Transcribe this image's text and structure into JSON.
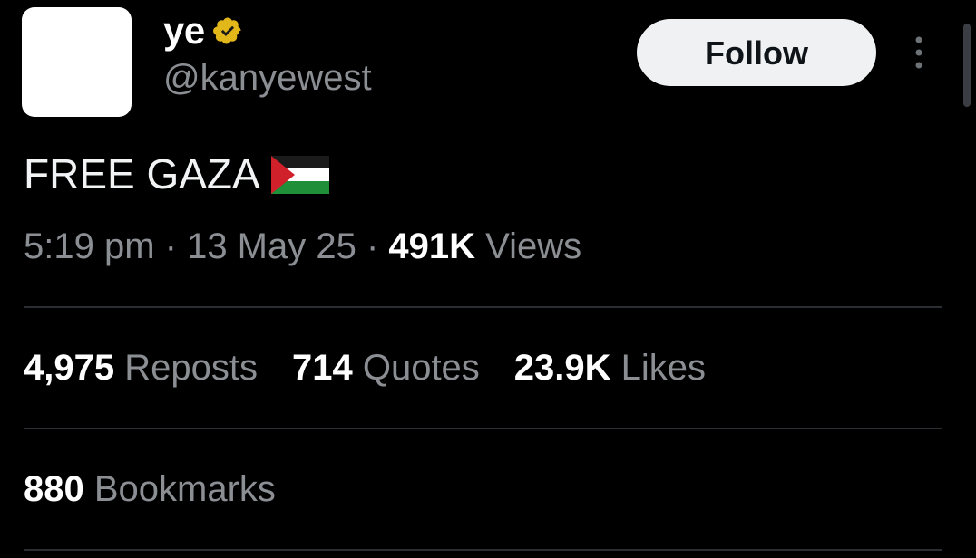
{
  "author": {
    "display_name": "ye",
    "handle": "@kanyewest",
    "verified_icon": "verified-badge-icon",
    "verified_color": "#e2b719"
  },
  "actions": {
    "follow_label": "Follow",
    "more_icon": "more-vertical-icon"
  },
  "tweet": {
    "text": "FREE GAZA",
    "emoji_icon": "palestine-flag-icon"
  },
  "meta": {
    "time": "5:19 pm",
    "sep1": " · ",
    "date": "13 May 25",
    "sep2": " · ",
    "views_count": "491K",
    "views_label": " Views"
  },
  "stats": {
    "reposts_count": "4,975",
    "reposts_label": " Reposts",
    "quotes_count": "714",
    "quotes_label": " Quotes",
    "likes_count": "23.9K",
    "likes_label": " Likes",
    "bookmarks_count": "880",
    "bookmarks_label": " Bookmarks"
  },
  "colors": {
    "background": "#000000",
    "follow_button_bg": "#eff1f2",
    "secondary_text": "#8b8f94"
  }
}
